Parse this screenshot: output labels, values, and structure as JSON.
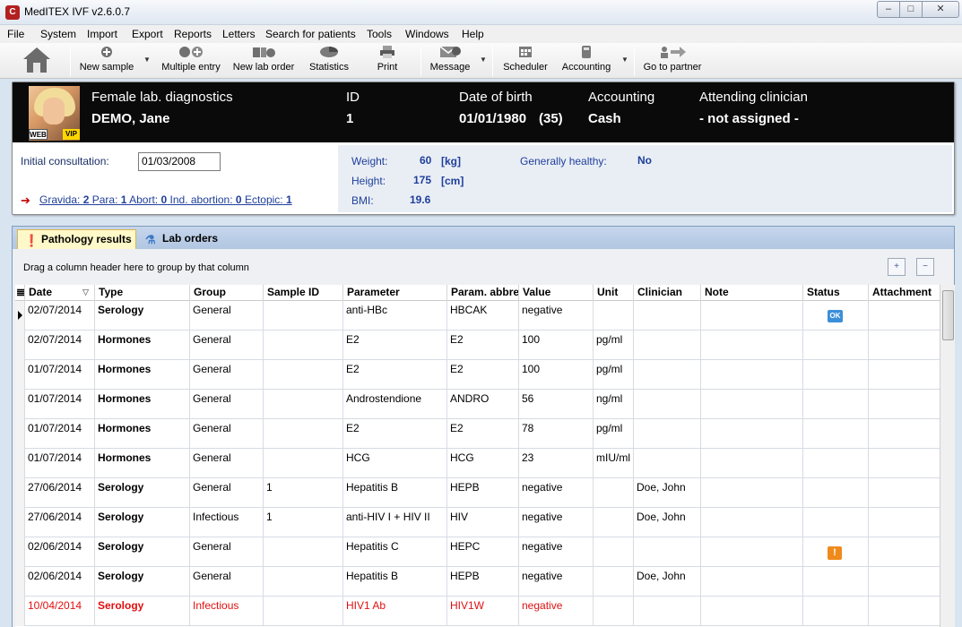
{
  "window": {
    "title": "MedITEX IVF v2.6.0.7",
    "app_icon_text": "C",
    "min_label": "‒",
    "max_label": "□",
    "close_label": "✕"
  },
  "menu": [
    "File",
    "System",
    "Import",
    "Export",
    "Reports",
    "Letters",
    "Search for patients",
    "Tools",
    "Windows",
    "Help"
  ],
  "toolbar": {
    "new_sample": "New sample",
    "multiple_entry": "Multiple entry",
    "new_lab_order": "New lab order",
    "statistics": "Statistics",
    "print": "Print",
    "message": "Message",
    "scheduler": "Scheduler",
    "accounting": "Accounting",
    "go_to_partner": "Go to partner"
  },
  "patient": {
    "photo_badge_web": "WEB",
    "photo_badge_vip": "VIP",
    "section_label": "Female lab. diagnostics",
    "name": "DEMO, Jane",
    "id_label": "ID",
    "id_value": "1",
    "dob_label": "Date of birth",
    "dob_value": "01/01/1980",
    "age": "(35)",
    "accounting_label": "Accounting",
    "accounting_value": "Cash",
    "clinician_label": "Attending clinician",
    "clinician_value": "- not assigned -",
    "consult_label": "Initial consultation:",
    "consult_value": "01/03/2008",
    "gravida_label": "Gravida:",
    "gravida_value": "2",
    "para_label": "Para:",
    "para_value": "1",
    "abort_label": "Abort:",
    "abort_value": "0",
    "ind_abortion_label": "Ind. abortion:",
    "ind_abortion_value": "0",
    "ectopic_label": "Ectopic:",
    "ectopic_value": "1",
    "weight_label": "Weight:",
    "weight_value": "60",
    "weight_unit": "[kg]",
    "height_label": "Height:",
    "height_value": "175",
    "height_unit": "[cm]",
    "bmi_label": "BMI:",
    "bmi_value": "19.6",
    "healthy_label": "Generally healthy:",
    "healthy_value": "No"
  },
  "tabs": {
    "pathology": "Pathology results",
    "lab_orders": "Lab orders"
  },
  "grid": {
    "group_hint": "Drag a column header here to group by that column",
    "expand_label": "+",
    "collapse_label": "−",
    "columns": [
      "Date",
      "Type",
      "Group",
      "Sample ID",
      "Parameter",
      "Param. abbre",
      "Value",
      "Unit",
      "Clinician",
      "Note",
      "Status",
      "Attachment"
    ],
    "rows": [
      {
        "date": "02/07/2014",
        "type": "Serology",
        "group": "General",
        "sample": "",
        "param": "anti-HBc",
        "abbr": "HBCAK",
        "value": "negative",
        "unit": "",
        "clinician": "",
        "note": "",
        "status": "OK",
        "attachment": ""
      },
      {
        "date": "02/07/2014",
        "type": "Hormones",
        "group": "General",
        "sample": "",
        "param": "E2",
        "abbr": "E2",
        "value": "100",
        "unit": "pg/ml",
        "clinician": "",
        "note": "",
        "status": "",
        "attachment": ""
      },
      {
        "date": "01/07/2014",
        "type": "Hormones",
        "group": "General",
        "sample": "",
        "param": "E2",
        "abbr": "E2",
        "value": "100",
        "unit": "pg/ml",
        "clinician": "",
        "note": "",
        "status": "",
        "attachment": ""
      },
      {
        "date": "01/07/2014",
        "type": "Hormones",
        "group": "General",
        "sample": "",
        "param": "Androstendione",
        "abbr": "ANDRO",
        "value": "56",
        "unit": "ng/ml",
        "clinician": "",
        "note": "",
        "status": "",
        "attachment": ""
      },
      {
        "date": "01/07/2014",
        "type": "Hormones",
        "group": "General",
        "sample": "",
        "param": "E2",
        "abbr": "E2",
        "value": "78",
        "unit": "pg/ml",
        "clinician": "",
        "note": "",
        "status": "",
        "attachment": ""
      },
      {
        "date": "01/07/2014",
        "type": "Hormones",
        "group": "General",
        "sample": "",
        "param": "HCG",
        "abbr": "HCG",
        "value": "23",
        "unit": "mIU/ml",
        "clinician": "",
        "note": "",
        "status": "",
        "attachment": ""
      },
      {
        "date": "27/06/2014",
        "type": "Serology",
        "group": "General",
        "sample": "1",
        "param": "Hepatitis B",
        "abbr": "HEPB",
        "value": "negative",
        "unit": "",
        "clinician": "Doe, John",
        "note": "",
        "status": "",
        "attachment": ""
      },
      {
        "date": "27/06/2014",
        "type": "Serology",
        "group": "Infectious",
        "sample": "1",
        "param": "anti-HIV I + HIV II",
        "abbr": "HIV",
        "value": "negative",
        "unit": "",
        "clinician": "Doe, John",
        "note": "",
        "status": "",
        "attachment": ""
      },
      {
        "date": "02/06/2014",
        "type": "Serology",
        "group": "General",
        "sample": "",
        "param": "Hepatitis C",
        "abbr": "HEPC",
        "value": "negative",
        "unit": "",
        "clinician": "",
        "note": "",
        "status": "!",
        "attachment": ""
      },
      {
        "date": "02/06/2014",
        "type": "Serology",
        "group": "General",
        "sample": "",
        "param": "Hepatitis B",
        "abbr": "HEPB",
        "value": "negative",
        "unit": "",
        "clinician": "Doe, John",
        "note": "",
        "status": "",
        "attachment": ""
      },
      {
        "date": "10/04/2014",
        "type": "Serology",
        "group": "Infectious",
        "sample": "",
        "param": "HIV1 Ab",
        "abbr": "HIV1W",
        "value": "negative",
        "unit": "",
        "clinician": "",
        "note": "",
        "status": "",
        "attachment": "",
        "highlight": "red"
      }
    ]
  },
  "colors": {
    "header_bg": "#0a0a0a",
    "accent_blue": "#1f3f9a",
    "alert_red": "#e01010",
    "status_ok": "#3b8fd9",
    "status_warn": "#f08a1c",
    "tab_active": "#fff8c8"
  }
}
